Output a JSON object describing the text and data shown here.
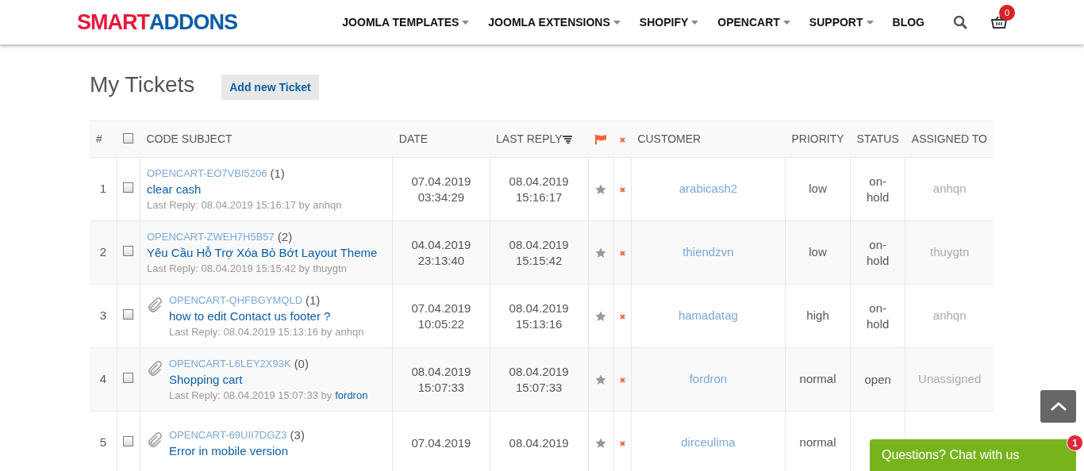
{
  "logo": {
    "part_1": "SMART",
    "part_2": "ADDONS"
  },
  "nav": [
    {
      "label": "JOOMLA TEMPLATES",
      "has_dropdown": true
    },
    {
      "label": "JOOMLA EXTENSIONS",
      "has_dropdown": true
    },
    {
      "label": "SHOPIFY",
      "has_dropdown": true
    },
    {
      "label": "OPENCART",
      "has_dropdown": true
    },
    {
      "label": "SUPPORT",
      "has_dropdown": true
    },
    {
      "label": "BLOG",
      "has_dropdown": false
    }
  ],
  "cart_count": "0",
  "page_title": "My Tickets",
  "add_button": "Add new Ticket",
  "table": {
    "columns": [
      "#",
      "CODE SUBJECT",
      "DATE",
      "LAST REPLY",
      "CUSTOMER",
      "PRIORITY",
      "STATUS",
      "ASSIGNED TO"
    ],
    "select_all_checked": false,
    "rows": [
      {
        "number": "1",
        "checked": false,
        "attachment": false,
        "code": "OPENCART-EO7VBI5206",
        "replies": "(1)",
        "subject": "clear cash",
        "last_reply": "Last Reply: 08.04.2019 15:16:17 by",
        "last_reply_user": "anhqn",
        "user_linked": false,
        "date": [
          "07.04.2019",
          "03:34:29"
        ],
        "last_reply_date": [
          "08.04.2019",
          "15:16:17"
        ],
        "customer": "arabicash2",
        "priority": "low",
        "status": "on-hold",
        "assigned_to": "anhqn"
      },
      {
        "number": "2",
        "checked": false,
        "attachment": false,
        "code": "OPENCART-ZWEH7H5B57",
        "replies": "(2)",
        "subject": "Yêu Cầu Hỗ Trợ Xóa Bỏ Bớt Layout Theme",
        "last_reply": "Last Reply: 08.04.2019 15:15:42 by",
        "last_reply_user": "thuygtn",
        "user_linked": false,
        "date": [
          "04.04.2019",
          "23:13:40"
        ],
        "last_reply_date": [
          "08.04.2019",
          "15:15:42"
        ],
        "customer": "thiendzvn",
        "priority": "low",
        "status": "on-hold",
        "assigned_to": "thuygtn"
      },
      {
        "number": "3",
        "checked": false,
        "attachment": true,
        "code": "OPENCART-QHFBGYMQLD",
        "replies": "(1)",
        "subject": "how to edit Contact us footer ?",
        "last_reply": "Last Reply: 08.04.2019 15:13:16 by",
        "last_reply_user": "anhqn",
        "user_linked": false,
        "date": [
          "07.04.2019",
          "10:05:22"
        ],
        "last_reply_date": [
          "08.04.2019",
          "15:13:16"
        ],
        "customer": "hamadatag",
        "priority": "high",
        "status": "on-hold",
        "assigned_to": "anhqn"
      },
      {
        "number": "4",
        "checked": false,
        "attachment": true,
        "code": "OPENCART-L6LEY2X93K",
        "replies": "(0)",
        "subject": "Shopping cart",
        "last_reply": "Last Reply: 08.04.2019 15:07:33 by",
        "last_reply_user": "fordron",
        "user_linked": true,
        "date": [
          "08.04.2019",
          "15:07:33"
        ],
        "last_reply_date": [
          "08.04.2019",
          "15:07:33"
        ],
        "customer": "fordron",
        "priority": "normal",
        "status": "open",
        "assigned_to": "Unassigned"
      },
      {
        "number": "5",
        "checked": false,
        "attachment": true,
        "code": "OPENCART-69UII7DGZ3",
        "replies": "(3)",
        "subject": "Error in mobile version",
        "date": [
          "07.04.2019"
        ],
        "last_reply_date": [
          "08.04.2019"
        ],
        "customer": "dirceulima",
        "priority": "normal"
      }
    ]
  },
  "chat": {
    "label": "Questions? Chat with us",
    "badge": "1"
  }
}
